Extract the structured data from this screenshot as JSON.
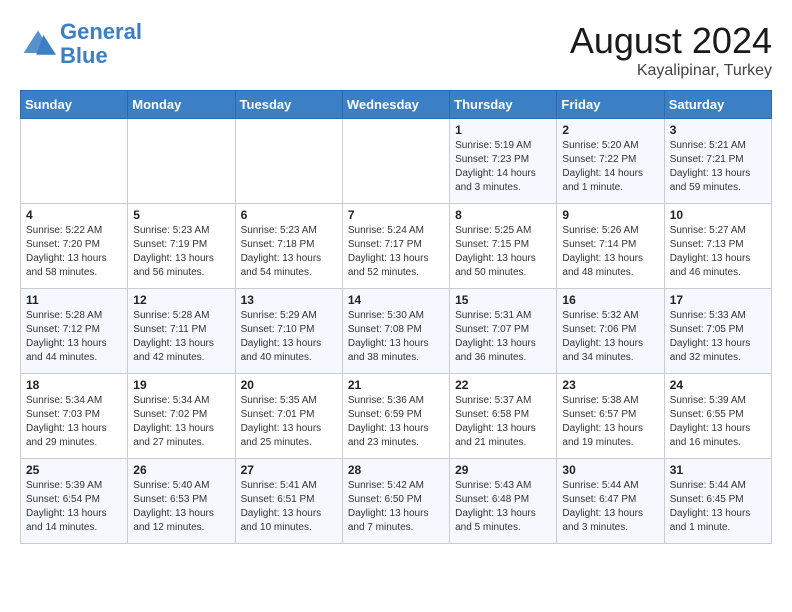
{
  "logo": {
    "line1": "General",
    "line2": "Blue"
  },
  "header": {
    "month_year": "August 2024",
    "location": "Kayalipinar, Turkey"
  },
  "days_of_week": [
    "Sunday",
    "Monday",
    "Tuesday",
    "Wednesday",
    "Thursday",
    "Friday",
    "Saturday"
  ],
  "weeks": [
    [
      {
        "day": "",
        "info": ""
      },
      {
        "day": "",
        "info": ""
      },
      {
        "day": "",
        "info": ""
      },
      {
        "day": "",
        "info": ""
      },
      {
        "day": "1",
        "info": "Sunrise: 5:19 AM\nSunset: 7:23 PM\nDaylight: 14 hours\nand 3 minutes."
      },
      {
        "day": "2",
        "info": "Sunrise: 5:20 AM\nSunset: 7:22 PM\nDaylight: 14 hours\nand 1 minute."
      },
      {
        "day": "3",
        "info": "Sunrise: 5:21 AM\nSunset: 7:21 PM\nDaylight: 13 hours\nand 59 minutes."
      }
    ],
    [
      {
        "day": "4",
        "info": "Sunrise: 5:22 AM\nSunset: 7:20 PM\nDaylight: 13 hours\nand 58 minutes."
      },
      {
        "day": "5",
        "info": "Sunrise: 5:23 AM\nSunset: 7:19 PM\nDaylight: 13 hours\nand 56 minutes."
      },
      {
        "day": "6",
        "info": "Sunrise: 5:23 AM\nSunset: 7:18 PM\nDaylight: 13 hours\nand 54 minutes."
      },
      {
        "day": "7",
        "info": "Sunrise: 5:24 AM\nSunset: 7:17 PM\nDaylight: 13 hours\nand 52 minutes."
      },
      {
        "day": "8",
        "info": "Sunrise: 5:25 AM\nSunset: 7:15 PM\nDaylight: 13 hours\nand 50 minutes."
      },
      {
        "day": "9",
        "info": "Sunrise: 5:26 AM\nSunset: 7:14 PM\nDaylight: 13 hours\nand 48 minutes."
      },
      {
        "day": "10",
        "info": "Sunrise: 5:27 AM\nSunset: 7:13 PM\nDaylight: 13 hours\nand 46 minutes."
      }
    ],
    [
      {
        "day": "11",
        "info": "Sunrise: 5:28 AM\nSunset: 7:12 PM\nDaylight: 13 hours\nand 44 minutes."
      },
      {
        "day": "12",
        "info": "Sunrise: 5:28 AM\nSunset: 7:11 PM\nDaylight: 13 hours\nand 42 minutes."
      },
      {
        "day": "13",
        "info": "Sunrise: 5:29 AM\nSunset: 7:10 PM\nDaylight: 13 hours\nand 40 minutes."
      },
      {
        "day": "14",
        "info": "Sunrise: 5:30 AM\nSunset: 7:08 PM\nDaylight: 13 hours\nand 38 minutes."
      },
      {
        "day": "15",
        "info": "Sunrise: 5:31 AM\nSunset: 7:07 PM\nDaylight: 13 hours\nand 36 minutes."
      },
      {
        "day": "16",
        "info": "Sunrise: 5:32 AM\nSunset: 7:06 PM\nDaylight: 13 hours\nand 34 minutes."
      },
      {
        "day": "17",
        "info": "Sunrise: 5:33 AM\nSunset: 7:05 PM\nDaylight: 13 hours\nand 32 minutes."
      }
    ],
    [
      {
        "day": "18",
        "info": "Sunrise: 5:34 AM\nSunset: 7:03 PM\nDaylight: 13 hours\nand 29 minutes."
      },
      {
        "day": "19",
        "info": "Sunrise: 5:34 AM\nSunset: 7:02 PM\nDaylight: 13 hours\nand 27 minutes."
      },
      {
        "day": "20",
        "info": "Sunrise: 5:35 AM\nSunset: 7:01 PM\nDaylight: 13 hours\nand 25 minutes."
      },
      {
        "day": "21",
        "info": "Sunrise: 5:36 AM\nSunset: 6:59 PM\nDaylight: 13 hours\nand 23 minutes."
      },
      {
        "day": "22",
        "info": "Sunrise: 5:37 AM\nSunset: 6:58 PM\nDaylight: 13 hours\nand 21 minutes."
      },
      {
        "day": "23",
        "info": "Sunrise: 5:38 AM\nSunset: 6:57 PM\nDaylight: 13 hours\nand 19 minutes."
      },
      {
        "day": "24",
        "info": "Sunrise: 5:39 AM\nSunset: 6:55 PM\nDaylight: 13 hours\nand 16 minutes."
      }
    ],
    [
      {
        "day": "25",
        "info": "Sunrise: 5:39 AM\nSunset: 6:54 PM\nDaylight: 13 hours\nand 14 minutes."
      },
      {
        "day": "26",
        "info": "Sunrise: 5:40 AM\nSunset: 6:53 PM\nDaylight: 13 hours\nand 12 minutes."
      },
      {
        "day": "27",
        "info": "Sunrise: 5:41 AM\nSunset: 6:51 PM\nDaylight: 13 hours\nand 10 minutes."
      },
      {
        "day": "28",
        "info": "Sunrise: 5:42 AM\nSunset: 6:50 PM\nDaylight: 13 hours\nand 7 minutes."
      },
      {
        "day": "29",
        "info": "Sunrise: 5:43 AM\nSunset: 6:48 PM\nDaylight: 13 hours\nand 5 minutes."
      },
      {
        "day": "30",
        "info": "Sunrise: 5:44 AM\nSunset: 6:47 PM\nDaylight: 13 hours\nand 3 minutes."
      },
      {
        "day": "31",
        "info": "Sunrise: 5:44 AM\nSunset: 6:45 PM\nDaylight: 13 hours\nand 1 minute."
      }
    ]
  ]
}
